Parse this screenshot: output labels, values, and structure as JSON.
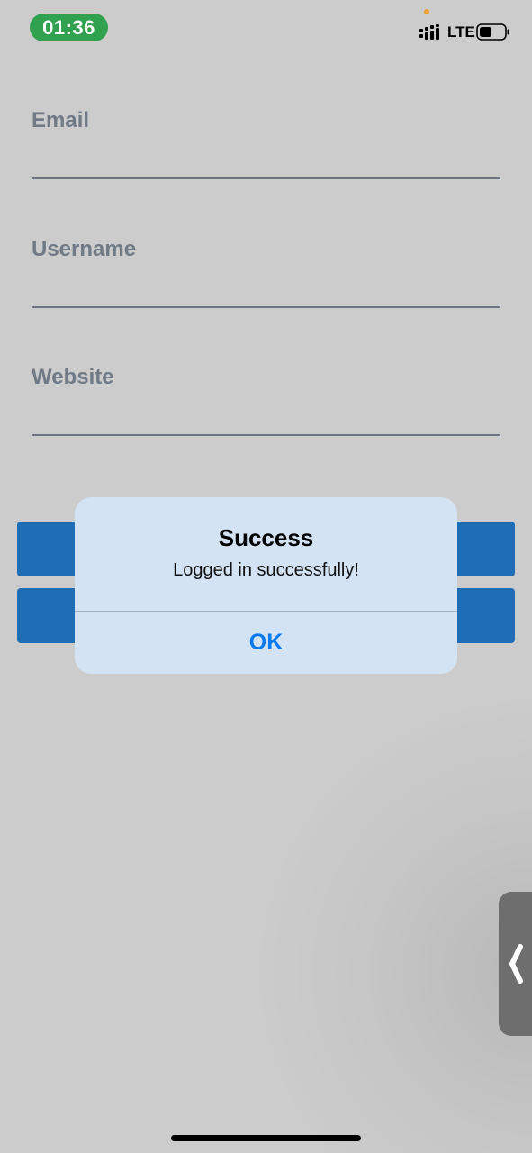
{
  "status_bar": {
    "time": "01:36",
    "network": "LTE",
    "icons": [
      "privacy-dot",
      "signal-icon",
      "battery-icon"
    ],
    "accent_color": "#30a14e"
  },
  "form": {
    "fields": [
      {
        "label": "Email",
        "value": ""
      },
      {
        "label": "Username",
        "value": ""
      },
      {
        "label": "Website",
        "value": ""
      }
    ],
    "buttons": [
      "",
      ""
    ],
    "button_color": "#1f6eb5"
  },
  "alert": {
    "title": "Success",
    "message": "Logged in successfully!",
    "ok_label": "OK",
    "ok_color": "#0a7af0"
  },
  "side_handle": {
    "icon": "chevron-left-icon"
  }
}
